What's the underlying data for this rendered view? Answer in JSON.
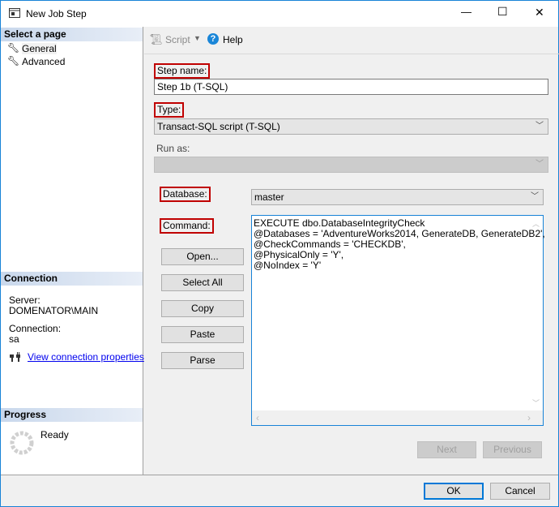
{
  "window": {
    "title": "New Job Step",
    "minimize": "—",
    "maximize": "☐",
    "close": "✕"
  },
  "left": {
    "select_page_header": "Select a page",
    "pages": [
      {
        "label": "General"
      },
      {
        "label": "Advanced"
      }
    ],
    "connection_header": "Connection",
    "server_label": "Server:",
    "server_value": "DOMENATOR\\MAIN",
    "connection_label": "Connection:",
    "connection_value": "sa",
    "view_connection_link": "View connection properties",
    "progress_header": "Progress",
    "progress_status": "Ready"
  },
  "toolbar": {
    "script_label": "Script",
    "help_label": "Help"
  },
  "form": {
    "step_name_label": "Step name:",
    "step_name_value": "Step 1b (T-SQL)",
    "type_label": "Type:",
    "type_value": "Transact-SQL script (T-SQL)",
    "run_as_label": "Run as:",
    "run_as_value": "",
    "database_label": "Database:",
    "database_value": "master",
    "command_label": "Command:",
    "command_text": "EXECUTE dbo.DatabaseIntegrityCheck\n@Databases = 'AdventureWorks2014, GenerateDB, GenerateDB2',\n@CheckCommands = 'CHECKDB',\n@PhysicalOnly = 'Y',\n@NoIndex = 'Y'",
    "buttons": {
      "open": "Open...",
      "select_all": "Select All",
      "copy": "Copy",
      "paste": "Paste",
      "parse": "Parse"
    },
    "next": "Next",
    "previous": "Previous"
  },
  "footer": {
    "ok": "OK",
    "cancel": "Cancel"
  }
}
